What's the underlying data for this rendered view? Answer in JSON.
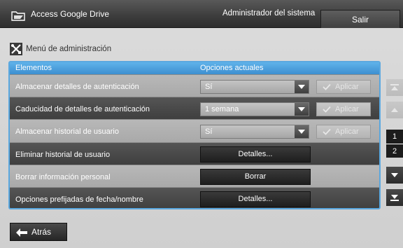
{
  "header": {
    "title": "Access Google Drive",
    "user": "Administrador del sistema",
    "logout_label": "Salir",
    "icon": "folder-icon"
  },
  "section": {
    "title": "Menú de administración",
    "icon": "tools-icon"
  },
  "table": {
    "col_items": "Elementos",
    "col_options": "Opciones actuales",
    "rows": [
      {
        "label": "Almacenar detalles de autenticación",
        "value": "Sí",
        "apply_label": "Aplicar"
      },
      {
        "label": "Caducidad de detalles de autenticación",
        "value": "1 semana",
        "apply_label": "Aplicar"
      },
      {
        "label": "Almacenar historial de usuario",
        "value": "Sí",
        "apply_label": "Aplicar"
      },
      {
        "label": "Eliminar historial de usuario",
        "button_label": "Detalles..."
      },
      {
        "label": "Borrar información personal",
        "button_label": "Borrar"
      },
      {
        "label": "Opciones prefijadas de fecha/nombre",
        "button_label": "Detalles..."
      }
    ]
  },
  "pagination": {
    "current_page": "1",
    "total_pages": "2"
  },
  "footer": {
    "back_label": "Atrás"
  },
  "colors": {
    "accent": "#4a9fe0",
    "top_bar": "#3c3c3c"
  }
}
